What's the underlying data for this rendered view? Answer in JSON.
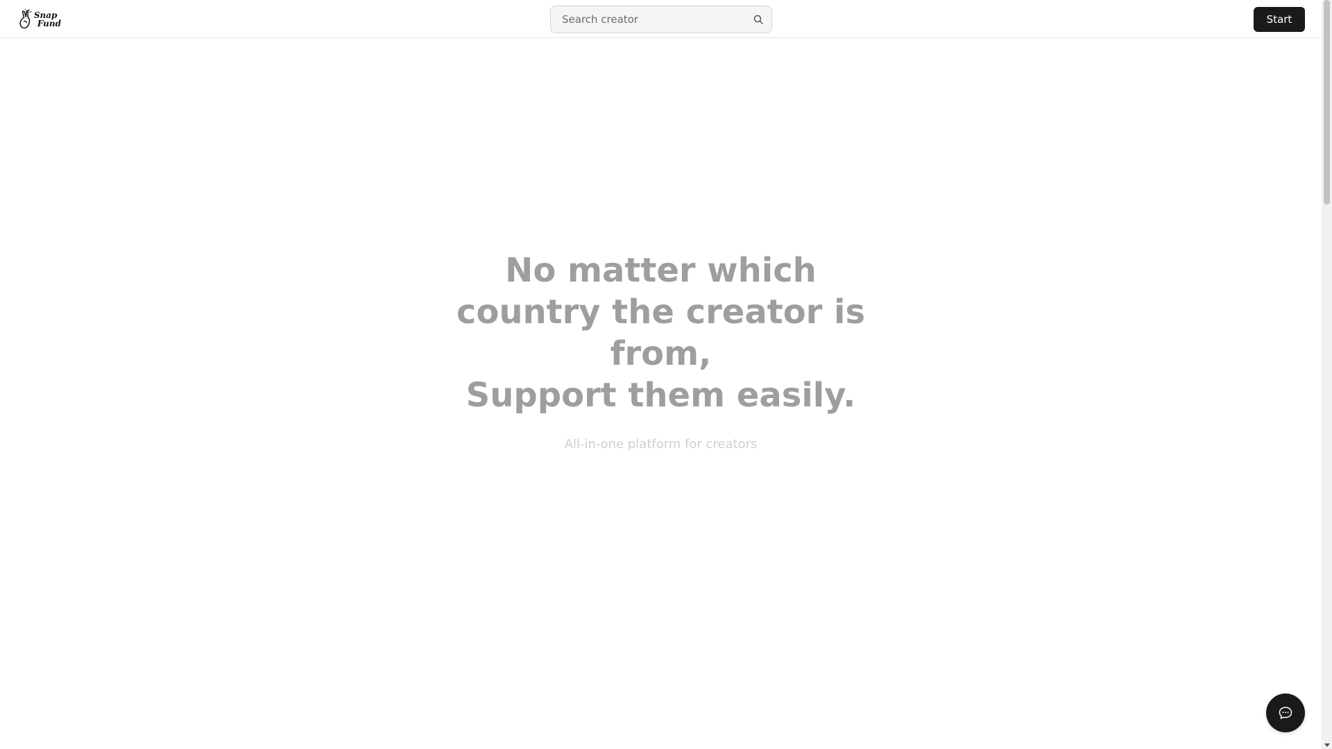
{
  "header": {
    "logo": {
      "line1": "Snap",
      "line2": "Fund"
    },
    "search": {
      "placeholder": "Search creator",
      "value": "",
      "icon": "search-icon"
    },
    "start_label": "Start"
  },
  "hero": {
    "title_lines": [
      "No matter which",
      "country the creator is",
      "from,",
      "Support them easily."
    ],
    "subtitle": "All-in-one platform for creators"
  },
  "chat": {
    "icon": "chat-bubble-icon"
  },
  "colors": {
    "primary_dark": "#1a1a1a",
    "hero_title": "#9e9e9e",
    "hero_subtitle": "#cfcfcf",
    "background": "#ffffff"
  }
}
